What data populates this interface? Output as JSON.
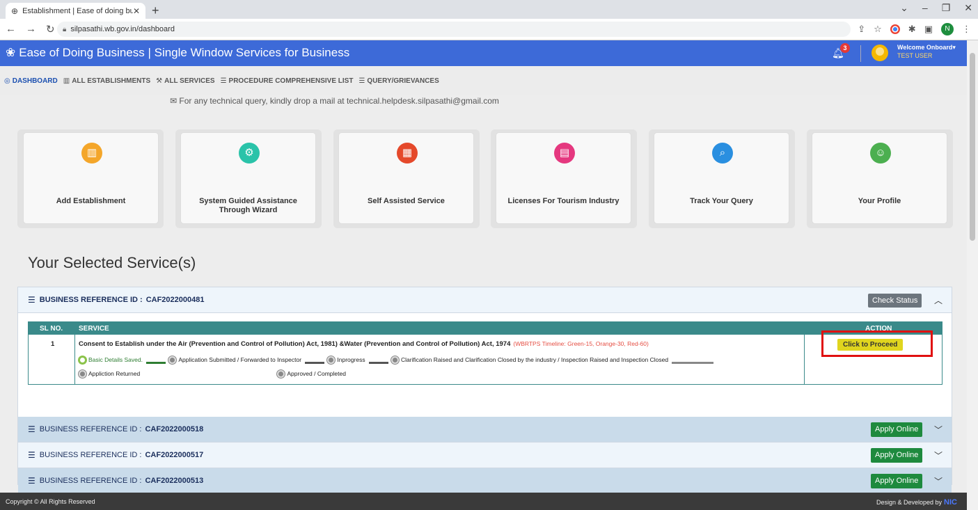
{
  "browser": {
    "tab_title": "Establishment | Ease of doing bu",
    "url": "silpasathi.wb.gov.in/dashboard",
    "profile_initial": "N"
  },
  "header": {
    "title": "Ease of Doing Business | Single Window Services for Business",
    "notification_count": "3",
    "welcome": "Welcome Onboard",
    "user": "TEST USER"
  },
  "menu": {
    "items": [
      {
        "label": "DASHBOARD",
        "icon": "dashboard-icon"
      },
      {
        "label": "ALL ESTABLISHMENTS",
        "icon": "building-icon"
      },
      {
        "label": "ALL SERVICES",
        "icon": "wrench-icon"
      },
      {
        "label": "PROCEDURE COMPREHENSIVE LIST",
        "icon": "list-icon"
      },
      {
        "label": "QUERY/GRIEVANCES",
        "icon": "list-icon"
      }
    ]
  },
  "help": {
    "text": "For any technical query, kindly drop a mail at technical.helpdesk.silpasathi@gmail.com"
  },
  "cards": [
    {
      "label": "Add Establishment",
      "icon": "building-icon",
      "color": "#f4a62a"
    },
    {
      "label": "System Guided Assistance Through Wizard",
      "icon": "gear-icon",
      "color": "#2ac3a9"
    },
    {
      "label": "Self Assisted Service",
      "icon": "grid-icon",
      "color": "#e5492b"
    },
    {
      "label": "Licenses For Tourism Industry",
      "icon": "license-icon",
      "color": "#e5387f"
    },
    {
      "label": "Track Your Query",
      "icon": "search-icon",
      "color": "#2a8fe0"
    },
    {
      "label": "Your Profile",
      "icon": "profile-icon",
      "color": "#4caf50"
    }
  ],
  "section": {
    "title": "Your Selected Service(s)"
  },
  "references": [
    {
      "prefix": "BUSINESS REFERENCE ID :",
      "id": "CAF2022000481",
      "button": "Check Status"
    },
    {
      "prefix": "BUSINESS REFERENCE ID :",
      "id": "CAF2022000518",
      "button": "Apply Online"
    },
    {
      "prefix": "BUSINESS REFERENCE ID :",
      "id": "CAF2022000517",
      "button": "Apply Online"
    },
    {
      "prefix": "BUSINESS REFERENCE ID :",
      "id": "CAF2022000513",
      "button": "Apply Online"
    }
  ],
  "table": {
    "headers": {
      "sl": "SL NO.",
      "service": "SERVICE",
      "action": "ACTION"
    },
    "row": {
      "sl": "1",
      "service": "Consent to Establish under the Air (Prevention and Control of Pollution) Act, 1981) &Water (Prevention and Control of Pollution) Act, 1974",
      "timeline": "(WBRTPS Timeline: Green-15, Orange-30, Red-60)",
      "action": "Click to Proceed",
      "steps": [
        "Basic Details Saved.",
        "Application Submitted / Forwarded to Inspector",
        "Inprogress",
        "Clarification Raised and Clarification Closed by the industry / Inspection Raised and Inspection Closed",
        "Appliction Returned",
        "Approved / Completed"
      ]
    }
  },
  "footer": {
    "copyright": "Copyright © All Rights Reserved",
    "design": "Design & Developed by",
    "nic": "NIC"
  }
}
